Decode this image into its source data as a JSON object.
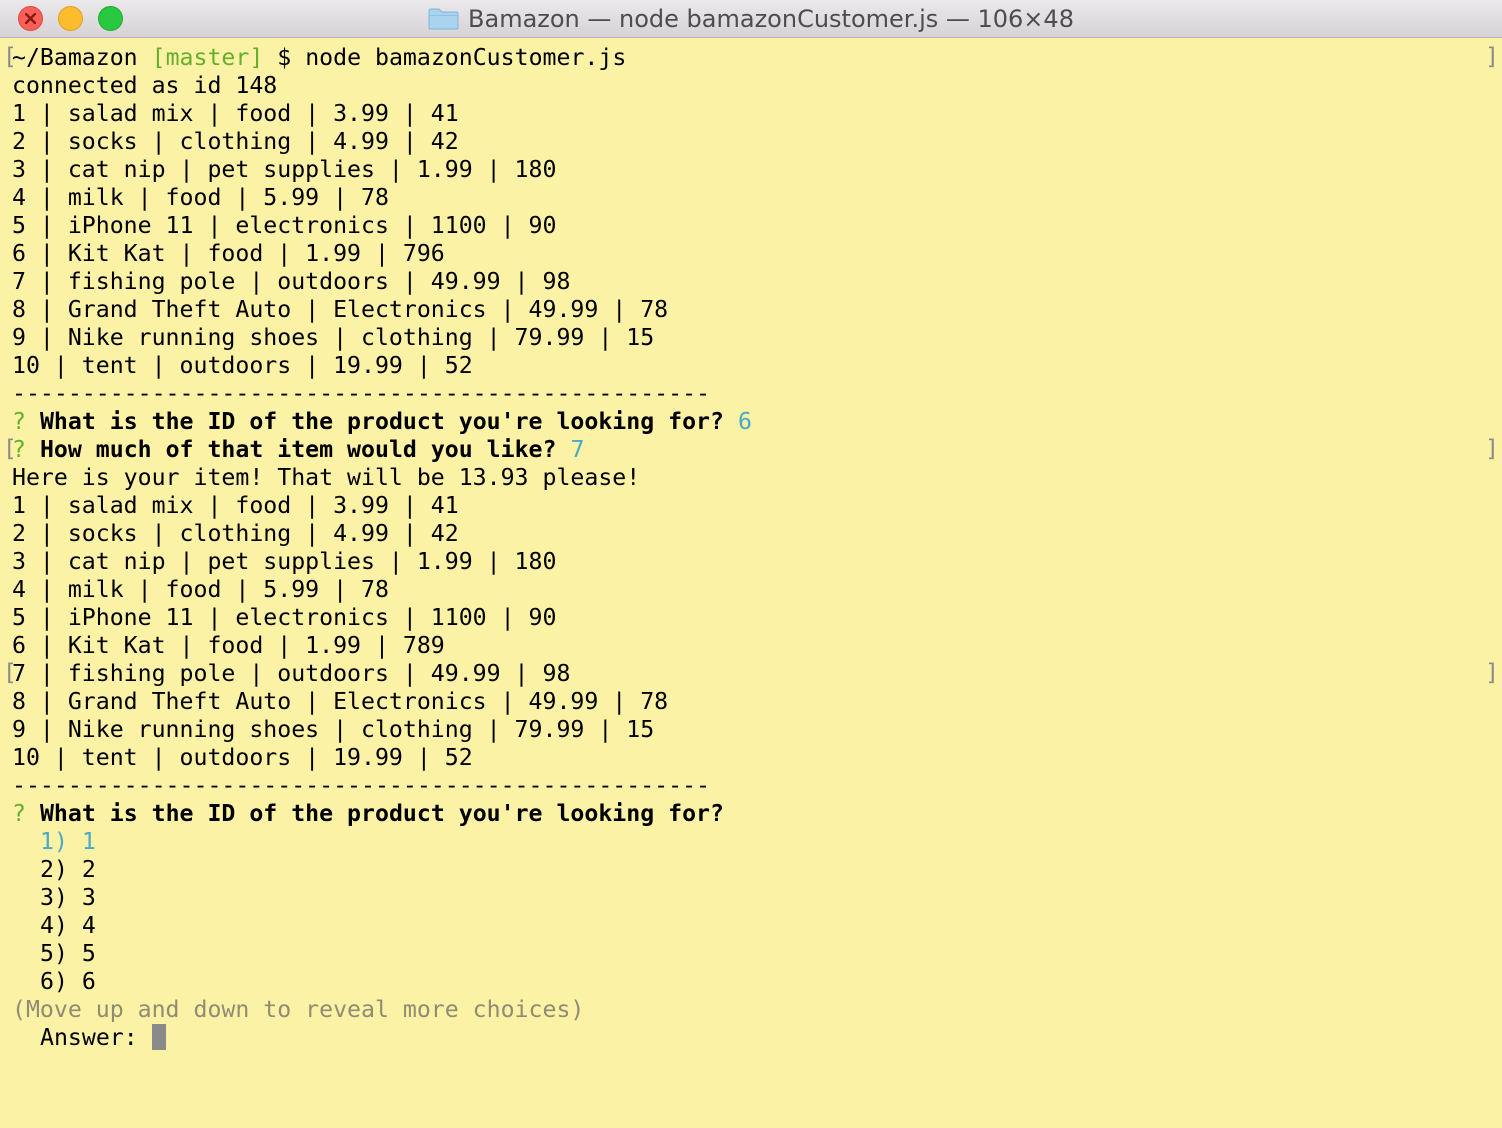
{
  "window": {
    "title": "Bamazon — node bamazonCustomer.js — 106×48",
    "accent": "#fcf2a6"
  },
  "prompt": {
    "cwd": "~/Bamazon",
    "branch": "[master]",
    "symbol": "$",
    "command": "node bamazonCustomer.js"
  },
  "connection": "connected as id 148",
  "inventory_first": [
    "1 | salad mix | food | 3.99 | 41",
    "2 | socks | clothing | 4.99 | 42",
    "3 | cat nip | pet supplies | 1.99 | 180",
    "4 | milk | food | 5.99 | 78",
    "5 | iPhone 11 | electronics | 1100 | 90",
    "6 | Kit Kat | food | 1.99 | 796",
    "7 | fishing pole | outdoors | 49.99 | 98",
    "8 | Grand Theft Auto | Electronics | 49.99 | 78",
    "9 | Nike running shoes | clothing | 79.99 | 15",
    "10 | tent | outdoors | 19.99 | 52"
  ],
  "separator": "--------------------------------------------------",
  "question_id": {
    "mark": "?",
    "text": "What is the ID of the product you're looking for?",
    "answer": "6"
  },
  "question_qty": {
    "mark": "?",
    "text": "How much of that item would you like?",
    "answer": "7"
  },
  "result": "Here is your item! That will be 13.93 please!",
  "inventory_second": [
    "1 | salad mix | food | 3.99 | 41",
    "2 | socks | clothing | 4.99 | 42",
    "3 | cat nip | pet supplies | 1.99 | 180",
    "4 | milk | food | 5.99 | 78",
    "5 | iPhone 11 | electronics | 1100 | 90",
    "6 | Kit Kat | food | 1.99 | 789",
    "7 | fishing pole | outdoors | 49.99 | 98",
    "8 | Grand Theft Auto | Electronics | 49.99 | 78",
    "9 | Nike running shoes | clothing | 79.99 | 15",
    "10 | tent | outdoors | 19.99 | 52"
  ],
  "question_id_2": {
    "mark": "?",
    "text": "What is the ID of the product you're looking for?"
  },
  "choices": [
    "1) 1",
    "2) 2",
    "3) 3",
    "4) 4",
    "5) 5",
    "6) 6"
  ],
  "choices_hint": "(Move up and down to reveal more choices)",
  "answer_label": "Answer:",
  "marks": {
    "left": "[",
    "right": "]"
  },
  "colors": {
    "background": "#fcf2a6",
    "branch": "#68ad2c",
    "answer": "#4aa9c7",
    "hint": "#908c74"
  }
}
